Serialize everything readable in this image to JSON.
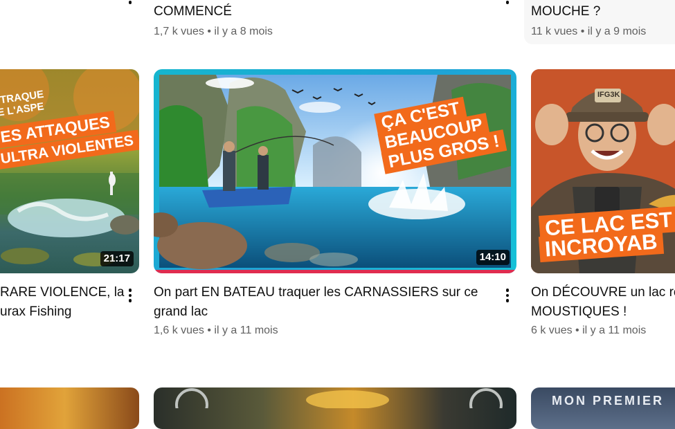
{
  "row_top": {
    "col2": {
      "title_line2": "COMMENCÉ",
      "meta": "1,7 k vues • il y a 8 mois"
    },
    "col3": {
      "title_line2": "MOUCHE ?",
      "meta": "11 k vues • il y a 9 mois"
    }
  },
  "row_middle": {
    "col1": {
      "duration": "21:17",
      "title_line1": "RARE VIOLENCE, la",
      "title_line2": "urax Fishing",
      "thumb_text": {
        "top1": "TRAQUE",
        "top2": "E L'ASPE",
        "line1": "ES ATTAQUES",
        "line2": "ULTRA VIOLENTES"
      }
    },
    "col2": {
      "duration": "14:10",
      "title_line1": "On part EN BATEAU traquer les CARNASSIERS sur ce",
      "title_line2": "grand lac",
      "meta": "1,6 k vues • il y a 11 mois",
      "thumb_text": {
        "line1": "ÇA C'EST",
        "line2": "BEAUCOUP",
        "line3": "PLUS GROS !"
      }
    },
    "col3": {
      "title_line1": "On DÉCOUVRE un lac re",
      "title_line2": "MOUSTIQUES !",
      "meta": "6 k vues • il y a 11 mois",
      "thumb_text": {
        "line1": "CE LAC EST",
        "line2": "INCROYAB"
      },
      "cap_text": "IFG3K"
    }
  },
  "row_bottom": {
    "col3": {
      "thumb_text": "MON PREMIER"
    }
  }
}
